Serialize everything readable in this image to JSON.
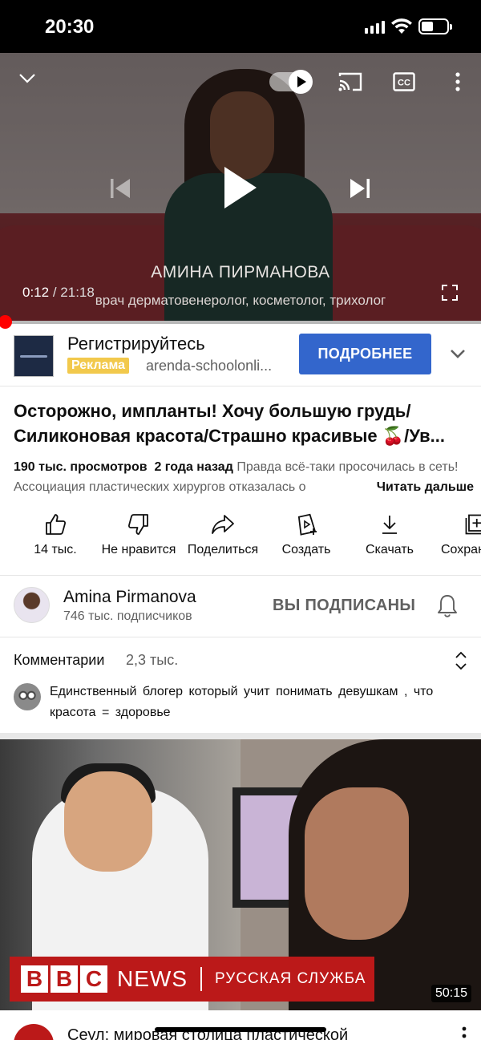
{
  "status_bar": {
    "time": "20:30",
    "battery_level": 0.45
  },
  "player": {
    "current_time": "0:12",
    "separator": "/",
    "duration": "21:18",
    "progress": 0.0094,
    "caption_name": "АМИНА ПИРМАНОВА",
    "caption_role": "врач дерматовенеролог, косметолог, трихолог",
    "autoplay_on": true
  },
  "ad": {
    "title": "Регистрируйтесь",
    "badge": "Реклама",
    "url": "arenda-schoolonli...",
    "cta": "ПОДРОБНЕЕ"
  },
  "video": {
    "title": "Осторожно, импланты! Хочу большую грудь/ Силиконовая красота/Страшно красивые 🍒/Ув...",
    "views": "190 тыс. просмотров",
    "age": "2 года назад",
    "description": "Правда всё-таки просочилась в сеть! Ассоциация пластических хирургов отказалась о",
    "read_more": "Читать дальше"
  },
  "actions": [
    {
      "label": "14 тыс.",
      "icon": "thumbs-up-icon"
    },
    {
      "label": "Не нравится",
      "icon": "thumbs-down-icon"
    },
    {
      "label": "Поделиться",
      "icon": "share-icon"
    },
    {
      "label": "Создать",
      "icon": "create-icon"
    },
    {
      "label": "Скачать",
      "icon": "download-icon"
    },
    {
      "label": "Сохран",
      "icon": "save-to-playlist-icon"
    }
  ],
  "channel": {
    "name": "Amina Pirmanova",
    "subscribers": "746 тыс. подписчиков",
    "subscribed_label": "ВЫ ПОДПИСАНЫ"
  },
  "comments": {
    "label": "Комментарии",
    "count": "2,3 тыс.",
    "top_comment": "Единственный  блогер который  учит понимать  девушкам , что красота = здоровье"
  },
  "next_video": {
    "bbc_letters": [
      "B",
      "B",
      "C"
    ],
    "bbc_news": "NEWS",
    "bbc_service": "РУССКАЯ СЛУЖБА",
    "duration": "50:15",
    "title": "Сеул: мировая столица пластической"
  },
  "colors": {
    "accent_red": "#ff0000",
    "cta_blue": "#3366cc",
    "ad_badge": "#f2c94c",
    "bbc_red": "#bb1919"
  }
}
